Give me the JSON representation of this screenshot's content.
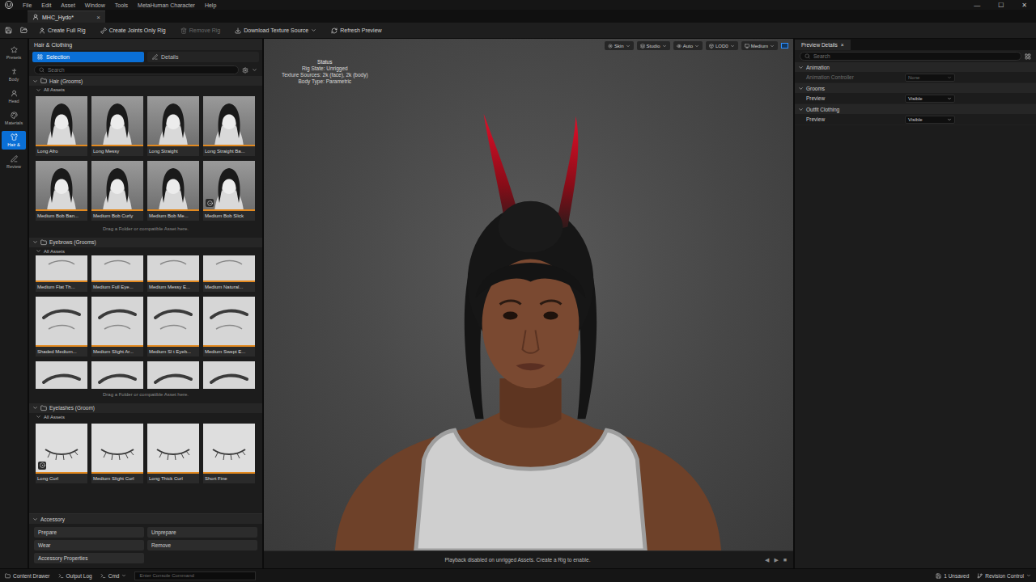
{
  "window": {
    "menu": [
      "File",
      "Edit",
      "Asset",
      "Window",
      "Tools",
      "MetaHuman Character",
      "Help"
    ],
    "controls": [
      "—",
      "☐",
      "✕"
    ]
  },
  "document_tab": {
    "label": "MHC_Hydo*",
    "close": "×",
    "selected": true
  },
  "toolbar": [
    {
      "label": "Create Full Rig",
      "disabled": false,
      "dropdown": false
    },
    {
      "label": "Create Joints Only Rig",
      "disabled": false,
      "dropdown": false
    },
    {
      "label": "Remove Rig",
      "disabled": true,
      "dropdown": false
    },
    {
      "label": "Download Texture Source",
      "disabled": false,
      "dropdown": true
    },
    {
      "label": "Refresh Preview",
      "disabled": false,
      "dropdown": false
    }
  ],
  "side_nav": [
    {
      "label": "Presets",
      "selected": false
    },
    {
      "label": "Body",
      "selected": false
    },
    {
      "label": "Head",
      "selected": false
    },
    {
      "label": "Materials",
      "selected": false
    },
    {
      "label": "Hair &",
      "selected": true
    },
    {
      "label": "Review",
      "selected": false
    }
  ],
  "left_panel": {
    "title": "Hair & Clothing",
    "tabs": [
      {
        "label": "Selection",
        "selected": true
      },
      {
        "label": "Details",
        "selected": false
      }
    ],
    "search": {
      "placeholder": "Search"
    },
    "sections": [
      {
        "title": "Hair (Grooms)",
        "kind": "hair",
        "expanded": true,
        "subtitle": "All Assets",
        "hint": "Drag a Folder or compatible Asset here.",
        "tiles": [
          {
            "label": "Long Afro",
            "badge": false
          },
          {
            "label": "Long Messy",
            "badge": false
          },
          {
            "label": "Long Straight",
            "badge": false
          },
          {
            "label": "Long Straight Ba...",
            "badge": false
          },
          {
            "label": "Medium Bob Ban...",
            "badge": false
          },
          {
            "label": "Medium Bob Curly",
            "badge": false
          },
          {
            "label": "Medium Bob Me...",
            "badge": false
          },
          {
            "label": "Medium Bob Slick",
            "badge": true
          }
        ]
      },
      {
        "title": "Eyebrows (Grooms)",
        "kind": "brows",
        "expanded": true,
        "subtitle": "All Assets",
        "hint": "Drag a Folder or compatible Asset here.",
        "tiles": [
          {
            "label": "Medium Flat Th...",
            "badge": false
          },
          {
            "label": "Medium Full Eye...",
            "badge": false
          },
          {
            "label": "Medium Messy E...",
            "badge": false
          },
          {
            "label": "Medium Natural...",
            "badge": false
          },
          {
            "label": "Shaded Medium...",
            "badge": false
          },
          {
            "label": "Medium Slight Ar...",
            "badge": false
          },
          {
            "label": "Medium Sl t Eyeb...",
            "badge": false
          },
          {
            "label": "Medium Swept E...",
            "badge": false
          },
          {
            "label": "",
            "badge": false
          },
          {
            "label": "",
            "badge": false
          },
          {
            "label": "",
            "badge": false
          },
          {
            "label": "",
            "badge": false
          }
        ]
      },
      {
        "title": "Eyelashes (Groom)",
        "kind": "lashes",
        "expanded": true,
        "subtitle": "All Assets",
        "hint": "",
        "tiles": [
          {
            "label": "Long Curl",
            "badge": true
          },
          {
            "label": "Medium Slight Curl",
            "badge": false
          },
          {
            "label": "Long Thick Curl",
            "badge": false
          },
          {
            "label": "Short Fine",
            "badge": false
          }
        ]
      }
    ],
    "accessory": {
      "title": "Accessory",
      "expanded": true,
      "buttons": [
        "Prepare",
        "Unprepare",
        "Wear",
        "Remove",
        "Accessory Properties"
      ]
    }
  },
  "viewport": {
    "controls": [
      "Skin",
      "Studio",
      "Auto",
      "LOD0",
      "Medium"
    ],
    "status": {
      "title": "Status",
      "lines": [
        "Rig State: Unrigged",
        "Texture Sources: 2k (face), 2k (body)",
        "Body Type: Parametric"
      ]
    },
    "message": "Playback disabled on unrigged Assets. Create a Rig to enable.",
    "playback": [
      "◀",
      "▶",
      "■"
    ]
  },
  "right_panel": {
    "tab": {
      "label": "Preview Details",
      "close": "×"
    },
    "search": {
      "placeholder": "Search"
    },
    "sections": [
      {
        "title": "Animation",
        "expanded": true,
        "rows": [
          {
            "label": "Animation Controller",
            "value": "None",
            "disabled": true
          }
        ]
      },
      {
        "title": "Grooms",
        "expanded": true,
        "rows": [
          {
            "label": "Preview",
            "value": "Visible",
            "disabled": false
          }
        ]
      },
      {
        "title": "Outfit Clothing",
        "expanded": true,
        "rows": [
          {
            "label": "Preview",
            "value": "Visible",
            "disabled": false
          }
        ]
      }
    ]
  },
  "status_bar": {
    "left": [
      "Content Drawer",
      "Output Log"
    ],
    "cmd": "Cmd",
    "console_placeholder": "Enter Console Command",
    "right": [
      "1 Unsaved",
      "Revision Control"
    ]
  }
}
